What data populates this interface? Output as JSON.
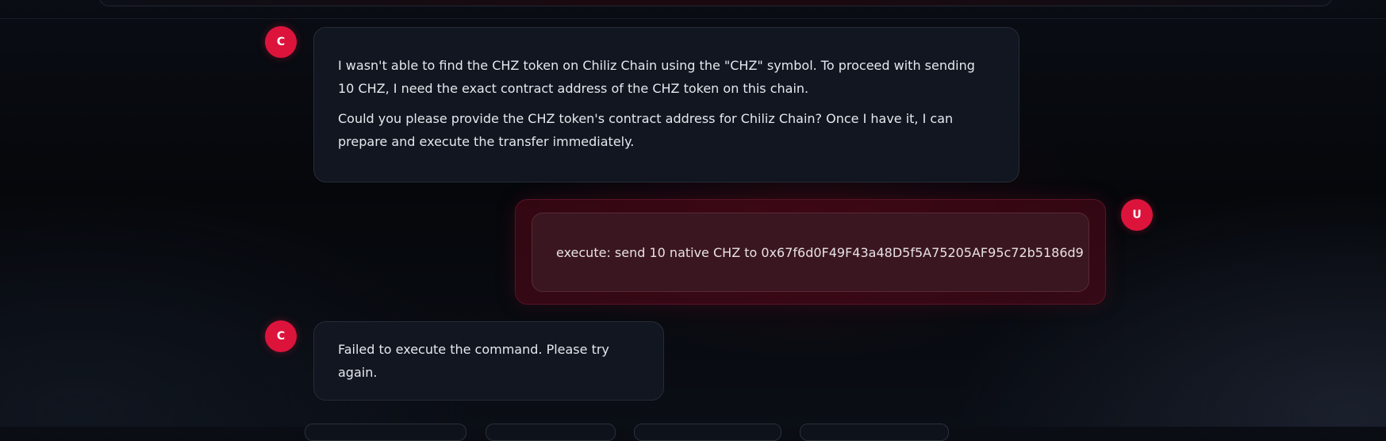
{
  "messages": [
    {
      "role": "assistant",
      "avatar_letter": "C",
      "paragraphs": [
        "I wasn't able to find the CHZ token on Chiliz Chain using the \"CHZ\" symbol. To proceed with sending 10 CHZ, I need the exact contract address of the CHZ token on this chain.",
        "Could you please provide the CHZ token's contract address for Chiliz Chain? Once I have it, I can prepare and execute the transfer immediately."
      ]
    },
    {
      "role": "user",
      "avatar_letter": "U",
      "text": "execute: send 10 native CHZ to 0x67f6d0F49F43a48D5f5A75205AF95c72b5186d9"
    },
    {
      "role": "assistant",
      "avatar_letter": "C",
      "text": "Failed to execute the command. Please try again."
    }
  ],
  "colors": {
    "accent": "#dc143c",
    "bubble_bg": "#111620",
    "user_bubble_bg": "#3a1620"
  }
}
